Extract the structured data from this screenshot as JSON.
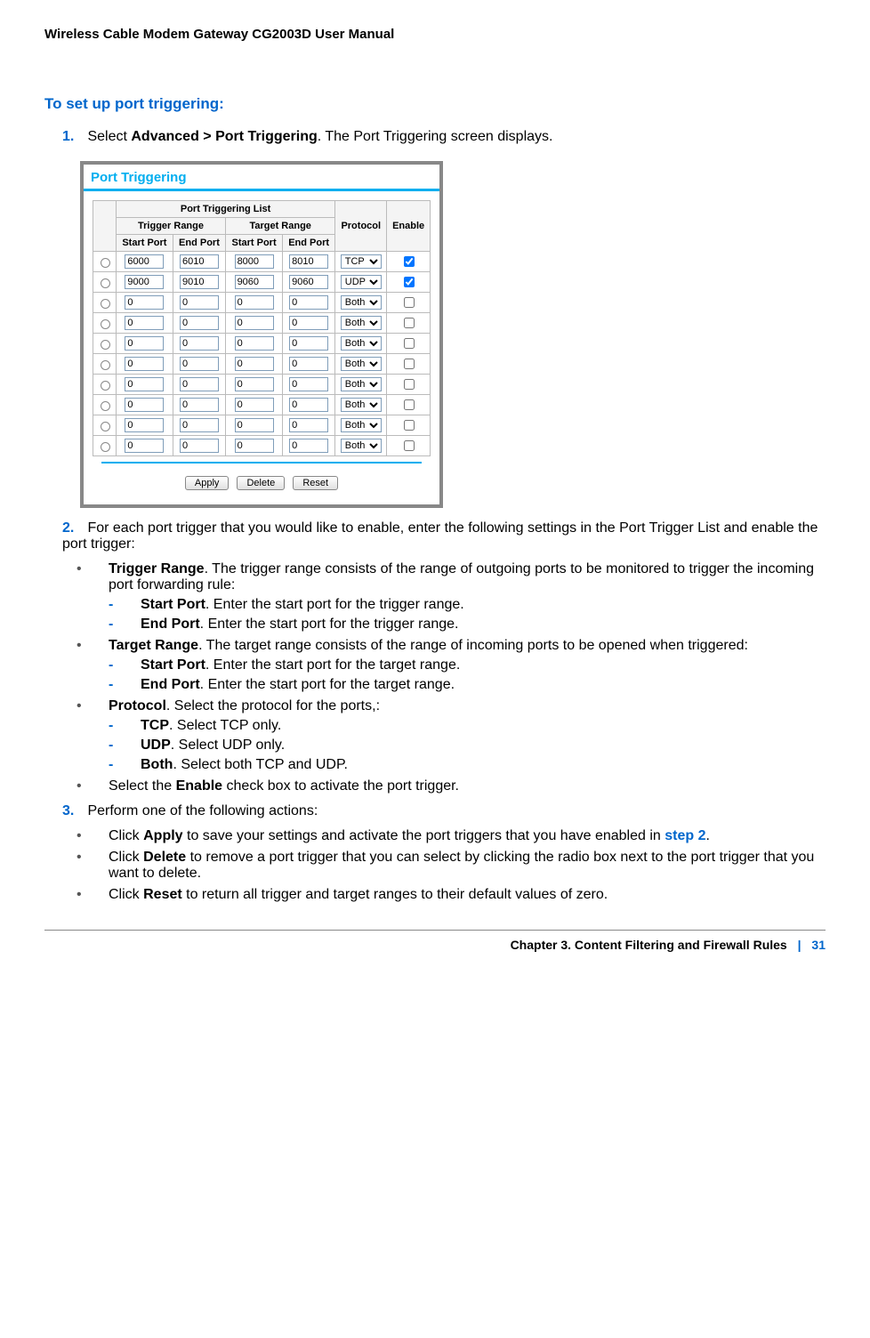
{
  "header": "Wireless Cable Modem Gateway CG2003D User Manual",
  "section_title": "To set up port triggering:",
  "step1": {
    "num": "1.",
    "text_before": "Select ",
    "bold": "Advanced > Port Triggering",
    "text_after": ". The Port Triggering screen displays."
  },
  "screenshot": {
    "title": "Port Triggering",
    "list_title": "Port Triggering List",
    "h_trigger": "Trigger Range",
    "h_target": "Target Range",
    "h_start": "Start Port",
    "h_end": "End Port",
    "h_protocol": "Protocol",
    "h_enable": "Enable",
    "rows": [
      {
        "ts": "6000",
        "te": "6010",
        "gs": "8000",
        "ge": "8010",
        "proto": "TCP",
        "checked": true
      },
      {
        "ts": "9000",
        "te": "9010",
        "gs": "9060",
        "ge": "9060",
        "proto": "UDP",
        "checked": true
      },
      {
        "ts": "0",
        "te": "0",
        "gs": "0",
        "ge": "0",
        "proto": "Both",
        "checked": false
      },
      {
        "ts": "0",
        "te": "0",
        "gs": "0",
        "ge": "0",
        "proto": "Both",
        "checked": false
      },
      {
        "ts": "0",
        "te": "0",
        "gs": "0",
        "ge": "0",
        "proto": "Both",
        "checked": false
      },
      {
        "ts": "0",
        "te": "0",
        "gs": "0",
        "ge": "0",
        "proto": "Both",
        "checked": false
      },
      {
        "ts": "0",
        "te": "0",
        "gs": "0",
        "ge": "0",
        "proto": "Both",
        "checked": false
      },
      {
        "ts": "0",
        "te": "0",
        "gs": "0",
        "ge": "0",
        "proto": "Both",
        "checked": false
      },
      {
        "ts": "0",
        "te": "0",
        "gs": "0",
        "ge": "0",
        "proto": "Both",
        "checked": false
      },
      {
        "ts": "0",
        "te": "0",
        "gs": "0",
        "ge": "0",
        "proto": "Both",
        "checked": false
      }
    ],
    "proto_options": [
      "TCP",
      "UDP",
      "Both"
    ],
    "btn_apply": "Apply",
    "btn_delete": "Delete",
    "btn_reset": "Reset"
  },
  "step2": {
    "num": "2.",
    "text": "For each port trigger that you would like to enable, enter the following settings in the Port Trigger List and enable the port trigger:"
  },
  "s2_trigger_range_b": "Trigger Range",
  "s2_trigger_range_t": ". The trigger range consists of the range of outgoing ports to be monitored to trigger the incoming port forwarding rule:",
  "s2_tr_start_b": "Start Port",
  "s2_tr_start_t": ". Enter the start port for the trigger range.",
  "s2_tr_end_b": "End Port",
  "s2_tr_end_t": ". Enter the start port for the trigger range.",
  "s2_target_range_b": "Target Range",
  "s2_target_range_t": ". The target range consists of the range of incoming ports to be opened when triggered:",
  "s2_tg_start_b": "Start Port",
  "s2_tg_start_t": ". Enter the start port for the target range.",
  "s2_tg_end_b": "End Port",
  "s2_tg_end_t": ". Enter the start port for the target range.",
  "s2_proto_b": "Protocol",
  "s2_proto_t": ". Select the protocol for the ports,:",
  "s2_tcp_b": "TCP",
  "s2_tcp_t": ". Select TCP only.",
  "s2_udp_b": "UDP",
  "s2_udp_t": ". Select UDP only.",
  "s2_both_b": "Both",
  "s2_both_t": ". Select both TCP and UDP.",
  "s2_enable_pre": "Select the ",
  "s2_enable_b": "Enable",
  "s2_enable_t": " check box to activate the port trigger.",
  "step3": {
    "num": "3.",
    "text": "Perform one of the following actions:"
  },
  "s3_apply_pre": "Click ",
  "s3_apply_b": "Apply",
  "s3_apply_mid": " to save your settings and activate the port triggers that you have enabled in ",
  "s3_apply_link": "step 2",
  "s3_apply_post": ".",
  "s3_delete_pre": "Click ",
  "s3_delete_b": "Delete",
  "s3_delete_t": " to remove a port trigger that you can select by clicking the radio box next to the port trigger that you want to delete.",
  "s3_reset_pre": "Click ",
  "s3_reset_b": "Reset",
  "s3_reset_t": " to return all trigger and target ranges to their default values of zero.",
  "footer": {
    "chapter": "Chapter 3.  Content Filtering and Firewall Rules",
    "sep": "|",
    "page": "31"
  }
}
